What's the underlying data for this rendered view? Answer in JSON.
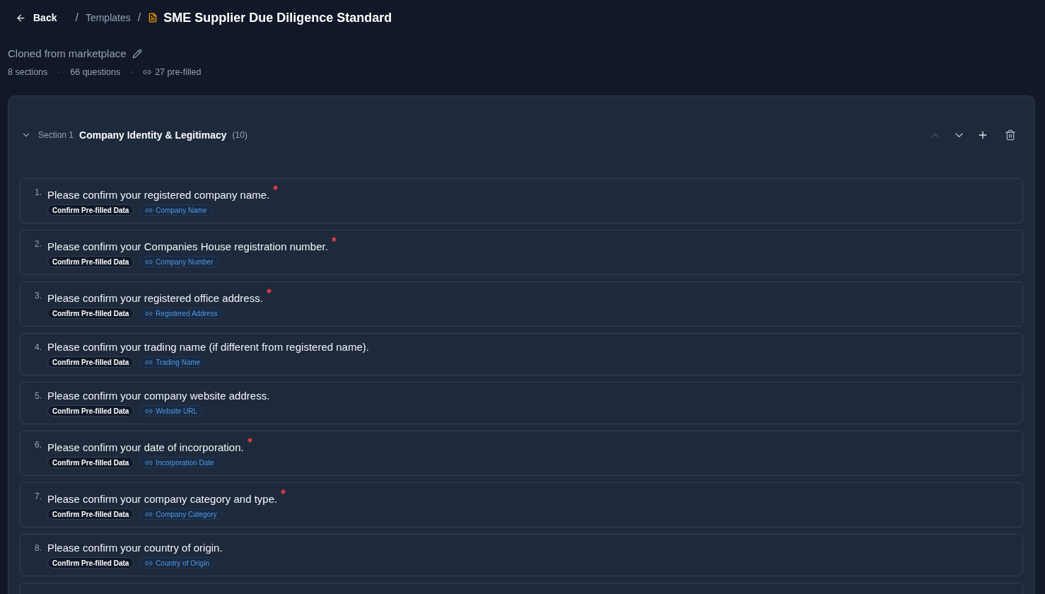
{
  "topbar": {
    "back": {
      "label": "Back"
    },
    "breadcrumb": [
      {
        "kind": "separator",
        "text": "/"
      },
      {
        "kind": "link",
        "text": "Templates"
      },
      {
        "kind": "separator",
        "text": "/"
      },
      {
        "kind": "current",
        "text": "SME Supplier Due Diligence Standard"
      }
    ]
  },
  "header": {
    "subtitle": "Cloned from marketplace",
    "stats": [
      {
        "kind": "plain",
        "text": "8 sections"
      },
      {
        "kind": "plain",
        "text": "66 questions"
      },
      {
        "kind": "linked",
        "text": "27 pre-filled"
      }
    ]
  },
  "section": {
    "label": "Section 1",
    "title": "Company Identity & Legitimacy",
    "count": "(10)",
    "expanded": true,
    "actions": [
      {
        "kind": "move_up",
        "disabled": true
      },
      {
        "kind": "move_down",
        "disabled": false
      },
      {
        "kind": "add",
        "disabled": false
      },
      {
        "kind": "delete",
        "disabled": false
      }
    ],
    "questions": [
      {
        "number": "1.",
        "text": "Please confirm your registered company name.",
        "required": true,
        "tags": [
          {
            "kind": "type",
            "text": "Confirm Pre-filled Data"
          },
          {
            "kind": "field",
            "text": "Company Name"
          }
        ]
      },
      {
        "number": "2.",
        "text": "Please confirm your Companies House registration number.",
        "required": true,
        "tags": [
          {
            "kind": "type",
            "text": "Confirm Pre-filled Data"
          },
          {
            "kind": "field",
            "text": "Company Number"
          }
        ]
      },
      {
        "number": "3.",
        "text": "Please confirm your registered office address.",
        "required": true,
        "tags": [
          {
            "kind": "type",
            "text": "Confirm Pre-filled Data"
          },
          {
            "kind": "field",
            "text": "Registered Address"
          }
        ]
      },
      {
        "number": "4.",
        "text": "Please confirm your trading name (if different from registered name).",
        "required": false,
        "tags": [
          {
            "kind": "type",
            "text": "Confirm Pre-filled Data"
          },
          {
            "kind": "field",
            "text": "Trading Name"
          }
        ]
      },
      {
        "number": "5.",
        "text": "Please confirm your company website address.",
        "required": false,
        "tags": [
          {
            "kind": "type",
            "text": "Confirm Pre-filled Data"
          },
          {
            "kind": "field",
            "text": "Website URL"
          }
        ]
      },
      {
        "number": "6.",
        "text": "Please confirm your date of incorporation.",
        "required": true,
        "tags": [
          {
            "kind": "type",
            "text": "Confirm Pre-filled Data"
          },
          {
            "kind": "field",
            "text": "Incorporation Date"
          }
        ]
      },
      {
        "number": "7.",
        "text": "Please confirm your company category and type.",
        "required": true,
        "tags": [
          {
            "kind": "type",
            "text": "Confirm Pre-filled Data"
          },
          {
            "kind": "field",
            "text": "Company Category"
          }
        ]
      },
      {
        "number": "8.",
        "text": "Please confirm your country of origin.",
        "required": false,
        "tags": [
          {
            "kind": "type",
            "text": "Confirm Pre-filled Data"
          },
          {
            "kind": "field",
            "text": "Country of Origin"
          }
        ]
      }
    ]
  }
}
